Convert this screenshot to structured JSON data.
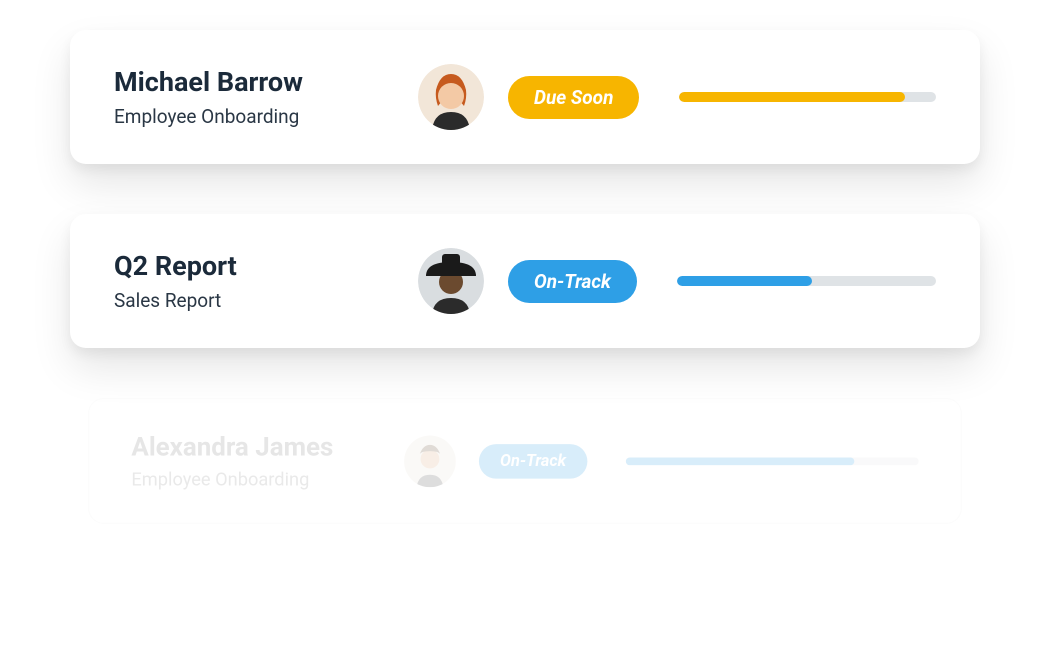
{
  "cards": [
    {
      "title": "Michael Barrow",
      "subtitle": "Employee Onboarding",
      "status_label": "Due Soon",
      "status_kind": "due-soon",
      "progress_percent": 88,
      "progress_color": "yellow",
      "avatar": "person-redhead"
    },
    {
      "title": "Q2 Report",
      "subtitle": "Sales Report",
      "status_label": "On-Track",
      "status_kind": "on-track",
      "progress_percent": 52,
      "progress_color": "blue",
      "avatar": "person-hat"
    },
    {
      "title": "Alexandra James",
      "subtitle": "Employee Onboarding",
      "status_label": "On-Track",
      "status_kind": "on-track",
      "progress_percent": 78,
      "progress_color": "blue",
      "avatar": "person-generic",
      "faded": true
    }
  ],
  "colors": {
    "due_soon": "#f7b500",
    "on_track": "#2e9fe6",
    "text_dark": "#1b2a3a"
  }
}
